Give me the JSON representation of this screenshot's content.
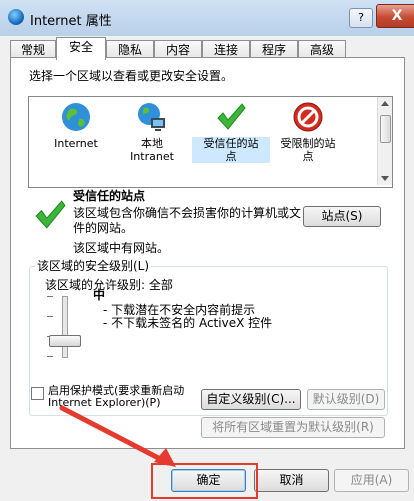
{
  "window": {
    "title": "Internet 属性",
    "help_label": "?",
    "close_label": "X"
  },
  "tabs": [
    {
      "label": "常规"
    },
    {
      "label": "安全"
    },
    {
      "label": "隐私"
    },
    {
      "label": "内容"
    },
    {
      "label": "连接"
    },
    {
      "label": "程序"
    },
    {
      "label": "高级"
    }
  ],
  "security": {
    "prompt": "选择一个区域以查看或更改安全设置。",
    "zones": [
      {
        "label": "Internet",
        "icon": "globe-icon",
        "selected": false
      },
      {
        "label": "本地\nIntranet",
        "icon": "intranet-icon",
        "selected": false
      },
      {
        "label": "受信任的站\n点",
        "icon": "check-icon",
        "selected": true
      },
      {
        "label": "受限制的站\n点",
        "icon": "no-entry-icon",
        "selected": false
      }
    ],
    "zone_title": "受信任的站点",
    "zone_description": "该区域包含你确信不会损害你的计算机或文件的网站。",
    "zone_note": "该区域中有网站。",
    "sites_button": "站点(S)",
    "level_group_title": "该区域的安全级别(L)",
    "allowed_levels": "该区域的允许级别: 全部",
    "level_name": "中",
    "level_points": [
      "- 下载潜在不安全内容前提示",
      "- 不下载未签名的 ActiveX 控件"
    ],
    "protected_mode_label": "启用保护模式(要求重新启动\nInternet Explorer)(P)",
    "protected_mode_checked": false,
    "custom_level_button": "自定义级别(C)...",
    "default_level_button": "默认级别(D)",
    "reset_all_button": "将所有区域重置为默认级别(R)",
    "slider_level": 0.33
  },
  "dialog_buttons": {
    "ok": "确定",
    "cancel": "取消",
    "apply": "应用(A)"
  },
  "colors": {
    "highlight": "#e53a2e"
  }
}
